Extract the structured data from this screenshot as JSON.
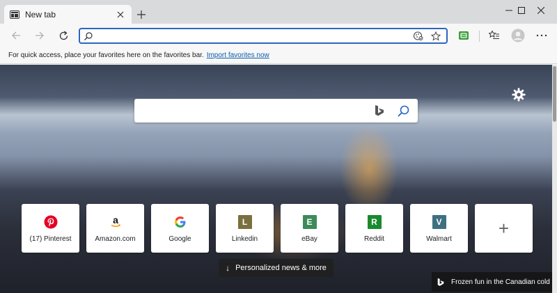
{
  "window": {
    "tab_title": "New tab",
    "new_tab_symbol": "+",
    "minimize_symbol": "—",
    "maximize_symbol": "☐",
    "close_symbol": "✕"
  },
  "toolbar": {
    "address_value": "",
    "address_placeholder": ""
  },
  "favorites_bar": {
    "message": "For quick access, place your favorites here on the favorites bar.",
    "import_link": "Import favorites now"
  },
  "search": {
    "value": "",
    "placeholder": ""
  },
  "tiles": [
    {
      "label": "(17) Pinterest",
      "icon": "pinterest-icon",
      "letter": "",
      "color": "#e60023"
    },
    {
      "label": "Amazon.com",
      "icon": "amazon-icon",
      "letter": "a",
      "color": "#000000"
    },
    {
      "label": "Google",
      "icon": "google-icon",
      "letter": "G",
      "color": "#4285f4"
    },
    {
      "label": "Linkedin",
      "icon": "linkedin-icon",
      "letter": "L",
      "color": "#7a6f3e"
    },
    {
      "label": "eBay",
      "icon": "ebay-icon",
      "letter": "E",
      "color": "#3e8a5a"
    },
    {
      "label": "Reddit",
      "icon": "reddit-icon",
      "letter": "R",
      "color": "#1a8a2e"
    },
    {
      "label": "Walmart",
      "icon": "walmart-icon",
      "letter": "V",
      "color": "#3e7080"
    }
  ],
  "add_tile_symbol": "+",
  "news_button": {
    "arrow": "↓",
    "label": "Personalized news & more"
  },
  "image_caption": "Frozen fun in the Canadian cold",
  "colors": {
    "accent": "#2a66c2",
    "link": "#0b5cad",
    "collections_green": "#3a9d3a"
  }
}
